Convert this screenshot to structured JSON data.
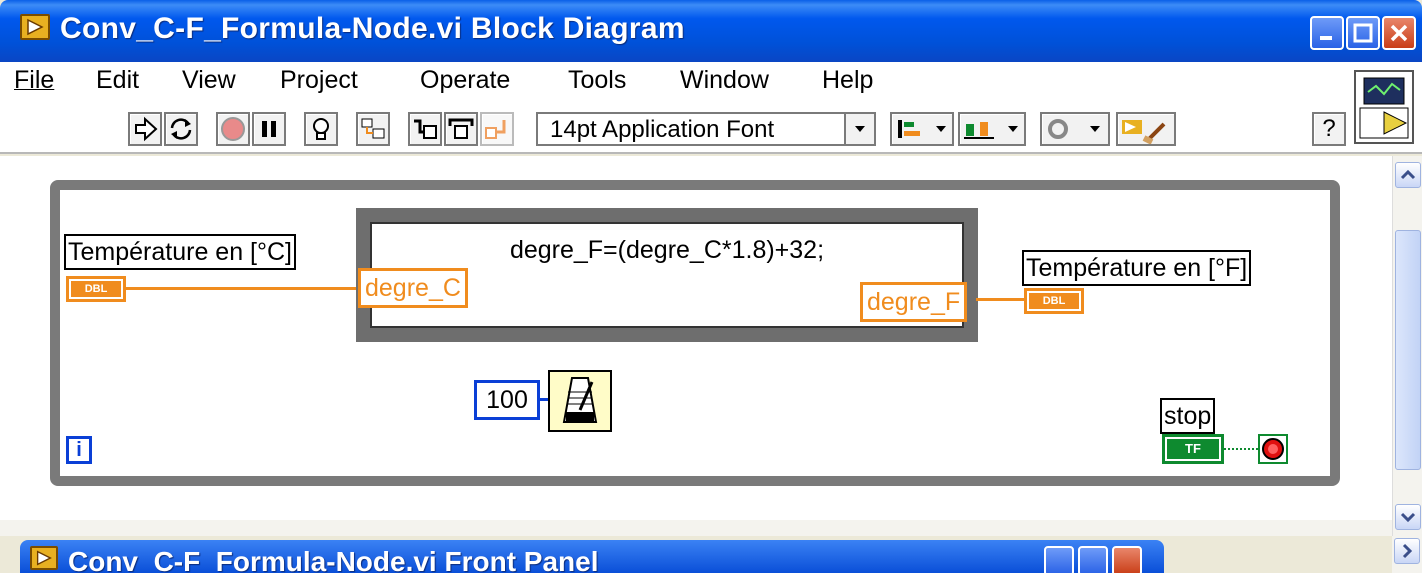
{
  "window": {
    "title": "Conv_C-F_Formula-Node.vi Block Diagram"
  },
  "menu": {
    "items": [
      "File",
      "Edit",
      "View",
      "Project",
      "Operate",
      "Tools",
      "Window",
      "Help"
    ]
  },
  "toolbar": {
    "font_select": "14pt Application Font",
    "help_glyph": "?"
  },
  "diagram": {
    "input_label": "Température en [°C]",
    "output_label": "Température en [°F]",
    "input_terminal_type": "DBL",
    "output_terminal_type": "DBL",
    "formula": "degre_F=(degre_C*1.8)+32;",
    "formula_input": "degre_C",
    "formula_output": "degre_F",
    "wait_constant": "100",
    "iteration_terminal": "i",
    "stop_label": "stop",
    "stop_terminal_type": "TF"
  },
  "overlap_window": {
    "title": "Conv_C-F_Formula-Node.vi Front Panel"
  },
  "colors": {
    "titlebar": "#0058EE",
    "orange_wire": "#F08C1E",
    "blue_terminal": "#0A3FD6",
    "green_terminal": "#0E8A2F",
    "loop_frame": "#7A7A7A"
  },
  "icons": {
    "app": "labview-vi-icon",
    "run": "run-arrow-icon",
    "run_continuous": "run-continuously-icon",
    "abort": "abort-icon",
    "pause": "pause-icon",
    "highlight": "highlight-execution-icon",
    "retain": "retain-wire-values-icon",
    "step_into": "step-into-icon",
    "step_over": "step-over-icon",
    "step_out": "step-out-icon",
    "align": "align-objects-icon",
    "distribute": "distribute-objects-icon",
    "reorder": "reorder-icon",
    "cleanup": "clean-up-diagram-icon",
    "wait": "metronome-icon"
  }
}
